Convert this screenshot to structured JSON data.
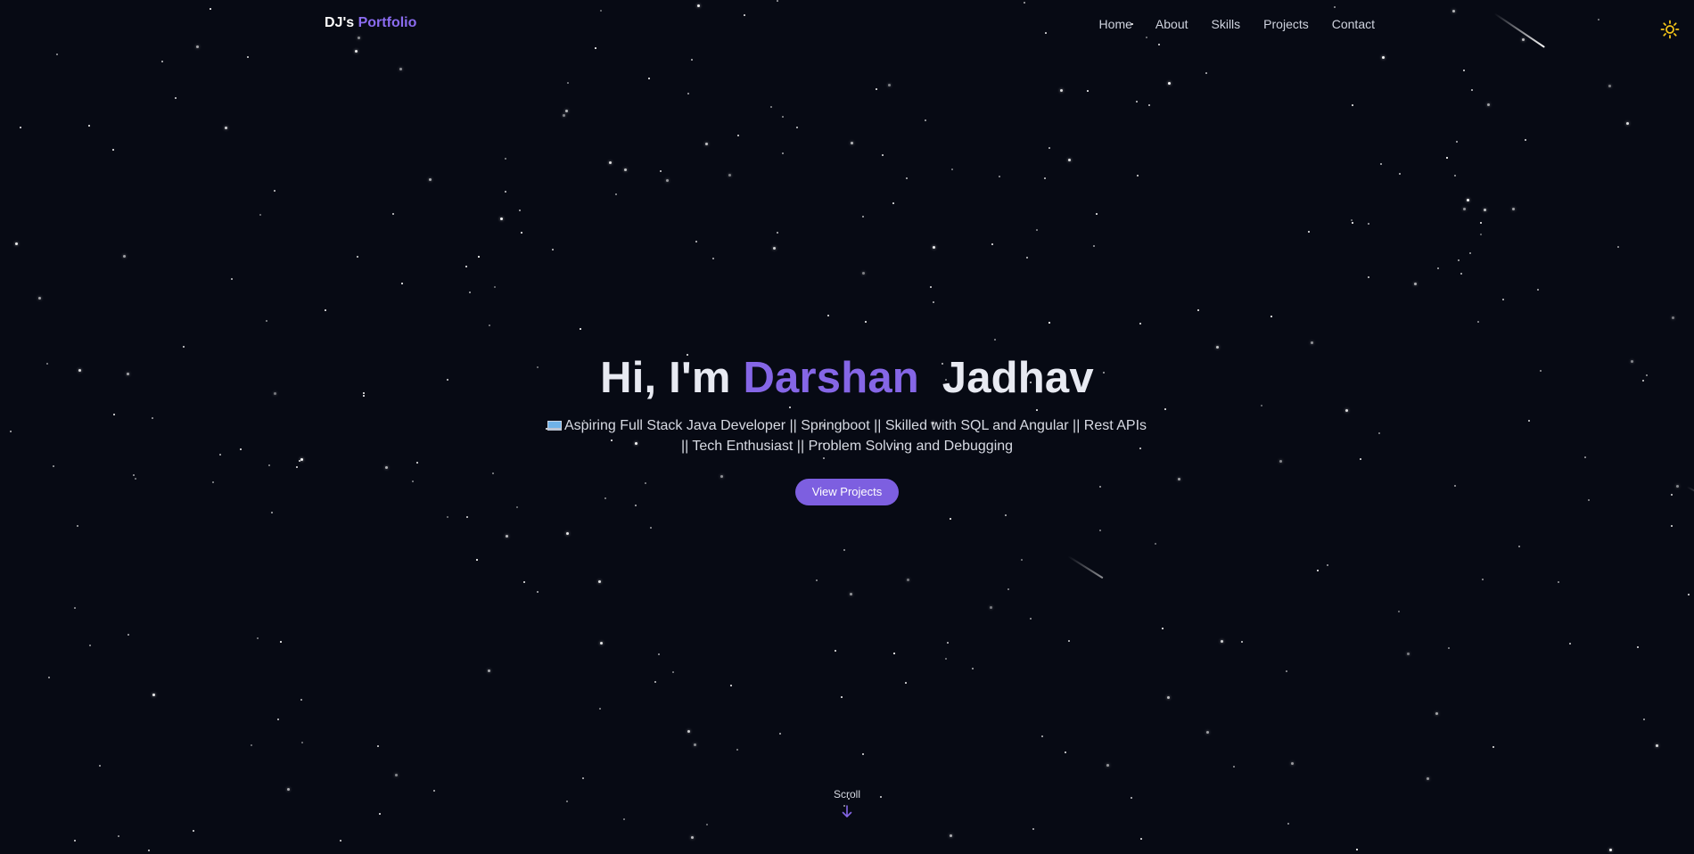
{
  "brand": {
    "prefix": "DJ's",
    "accent": "Portfolio"
  },
  "nav": {
    "items": [
      {
        "label": "Home"
      },
      {
        "label": "About"
      },
      {
        "label": "Skills"
      },
      {
        "label": "Projects"
      },
      {
        "label": "Contact"
      }
    ]
  },
  "theme_toggle": {
    "icon": "sun-icon"
  },
  "hero": {
    "greeting": "Hi, I'm",
    "first_name": "Darshan",
    "last_name": "Jadhav",
    "subtitle_icon": "laptop-icon",
    "subtitle": "Aspiring Full Stack Java Developer || Springboot || Skilled with SQL and Angular || Rest APIs || Tech Enthusiast || Problem Solving and Debugging",
    "cta_label": "View Projects"
  },
  "scroll": {
    "label": "Scroll",
    "icon": "arrow-down-icon"
  },
  "colors": {
    "background": "#070a14",
    "accent": "#8566e6",
    "button": "#7d5fe0",
    "sun": "#f5c518"
  }
}
